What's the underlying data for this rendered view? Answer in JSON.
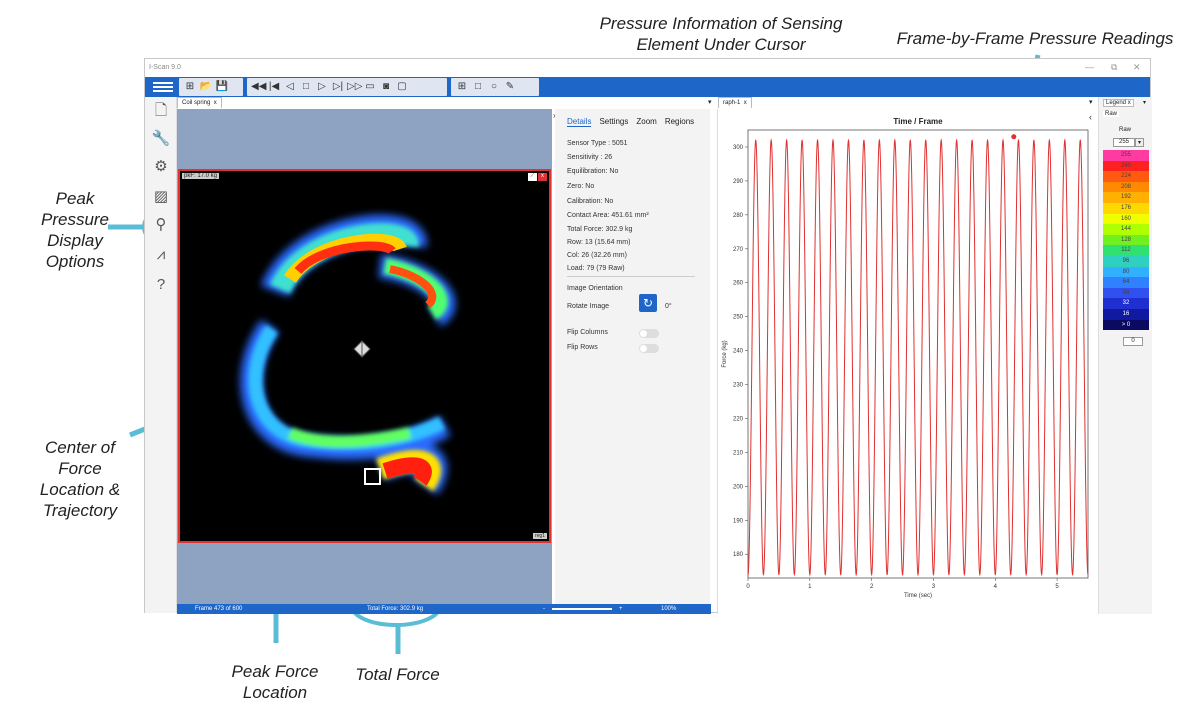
{
  "callouts": {
    "pressure_info": "Pressure Information of Sensing Element Under Cursor",
    "pressure_info_line1": "Pressure Information of Sensing",
    "pressure_info_line2": "Element Under Cursor",
    "frame_readings": "Frame-by-Frame Pressure Readings",
    "peak_display_1": "Peak",
    "peak_display_2": "Pressure",
    "peak_display_3": "Display",
    "peak_display_4": "Options",
    "cof_1": "Center of",
    "cof_2": "Force",
    "cof_3": "Location &",
    "cof_4": "Trajectory",
    "peak_force_1": "Peak Force",
    "peak_force_2": "Location",
    "total_force": "Total Force"
  },
  "window": {
    "title": "I-Scan 9.0",
    "minimize": "—",
    "restore": "⧉",
    "close": "✕"
  },
  "left_tab": {
    "label": "Coil spring",
    "close": "x"
  },
  "graph_tab": {
    "label": "raph-1",
    "close": "x"
  },
  "heatmap": {
    "peak_label": "pkF: 17.0 kg",
    "corner_label": "reg1"
  },
  "status_bar": {
    "frame": "Frame 473 of 600",
    "total_force": "Total Force: 302.9 kg",
    "zoom_minus": "-",
    "zoom_plus": "+",
    "zoom": "100%"
  },
  "details": {
    "tabs": [
      "Details",
      "Settings",
      "Zoom",
      "Regions"
    ],
    "sensor_type": "Sensor Type : 5051",
    "sensitivity": "Sensitivity : 26",
    "equilibration": "Equilibration: No",
    "zero": "Zero: No",
    "calibration": "Calibration: No",
    "contact_area": "Contact Area: 451.61 mm²",
    "total_force": "Total Force: 302.9 kg",
    "row": "Row: 13 (15.64 mm)",
    "col": "Col: 26 (32.26 mm)",
    "load": "Load: 79 (79 Raw)",
    "image_orientation": "Image Orientation",
    "rotate_image": "Rotate Image",
    "rotate_value": "0°",
    "flip_columns": "Flip Columns",
    "flip_rows": "Flip Rows"
  },
  "legend": {
    "tab": "Legend",
    "close": "x",
    "raw_tab": "Raw",
    "raw_label": "Raw",
    "max_value": "255",
    "min_value": "0",
    "levels": [
      "255",
      "240",
      "224",
      "208",
      "192",
      "176",
      "160",
      "144",
      "128",
      "112",
      "96",
      "80",
      "64",
      "48",
      "32",
      "16",
      "> 0"
    ],
    "colors": [
      "#ff3aa0",
      "#ff2020",
      "#ff5a10",
      "#ff8a00",
      "#ffb000",
      "#ffd800",
      "#f0ff00",
      "#b0ff00",
      "#70f020",
      "#30e070",
      "#30d0c0",
      "#30b0ff",
      "#3080ff",
      "#3050f0",
      "#2030d0",
      "#101aa0",
      "#0a0a60"
    ]
  },
  "chart_data": {
    "type": "line",
    "title": "Time / Frame",
    "xlabel": "Time (sec)",
    "ylabel": "Force (kg)",
    "xlim": [
      0,
      5.5
    ],
    "ylim": [
      173,
      305
    ],
    "x_ticks": [
      0,
      1,
      2,
      3,
      4,
      5
    ],
    "y_ticks": [
      180,
      190,
      200,
      210,
      220,
      230,
      240,
      250,
      260,
      270,
      280,
      290,
      300
    ],
    "grid": false,
    "series": [
      {
        "line_color": "#e03030",
        "cycles": 22,
        "peak_value": 302,
        "trough_value": 174,
        "period_sec": 0.25
      }
    ],
    "marker": {
      "x": 4.3,
      "y": 303
    }
  },
  "colors": {
    "toolbar_blue": "#1f66c9",
    "callout_cyan": "#5bbcd6",
    "heatmap_border": "#d33333"
  }
}
